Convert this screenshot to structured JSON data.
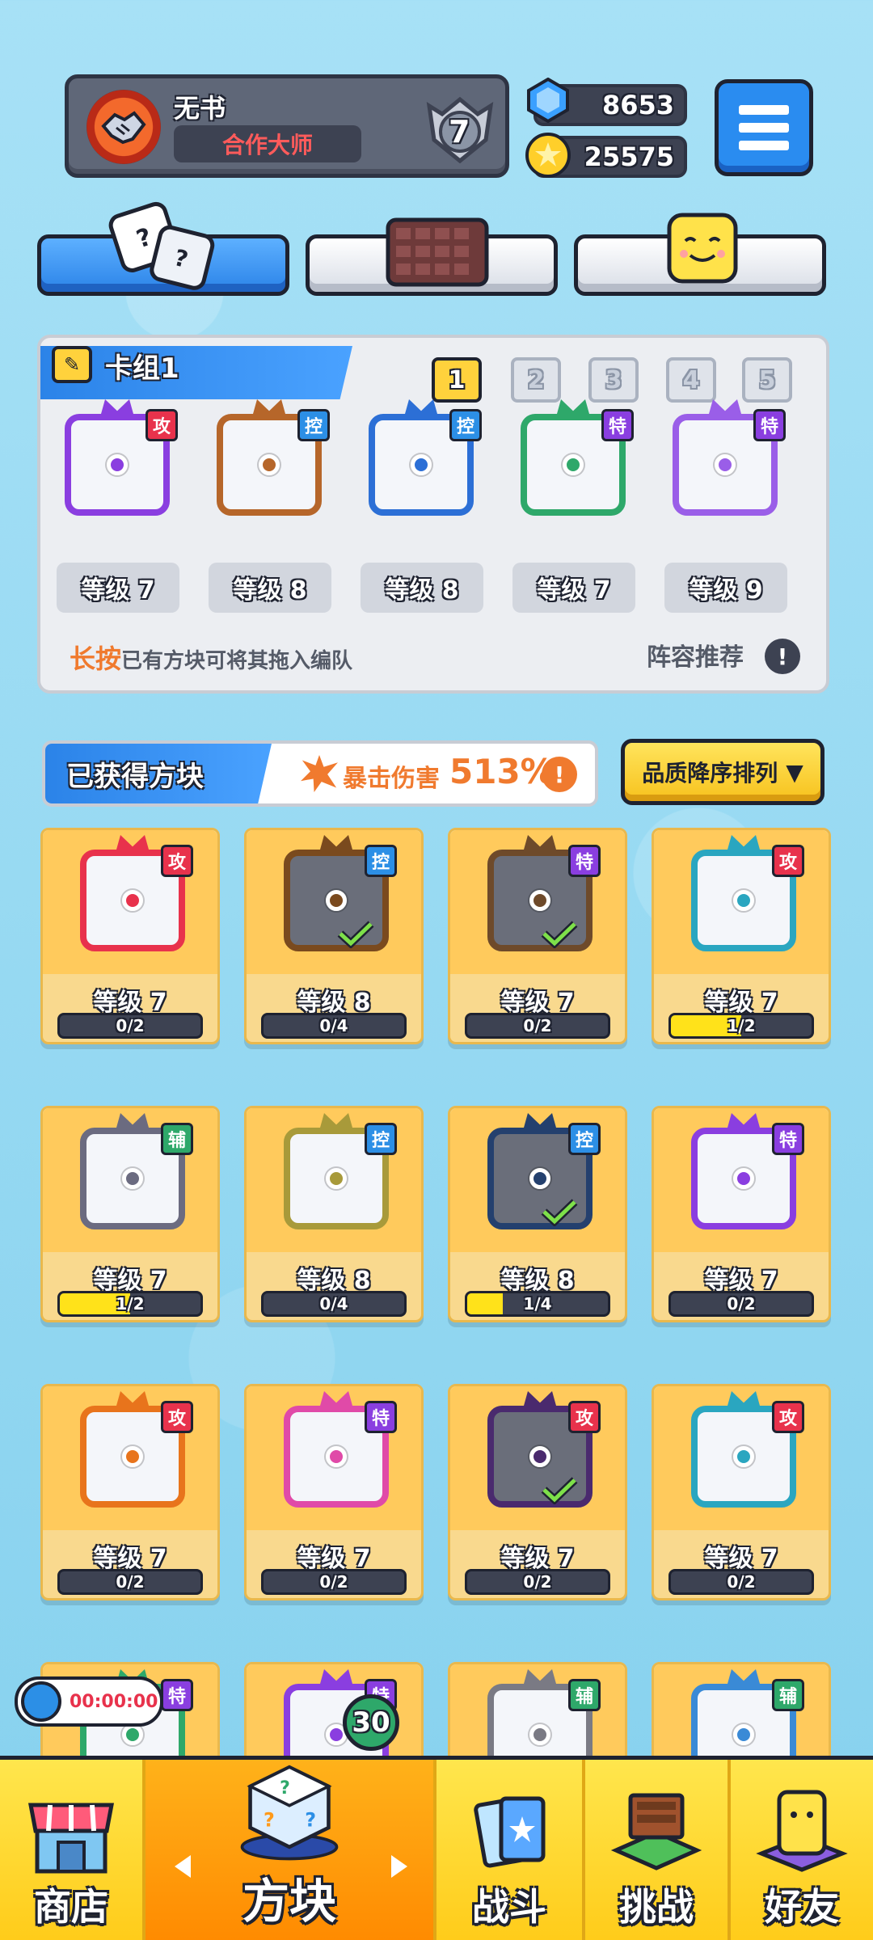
{
  "profile": {
    "name": "无书",
    "title": "合作大师",
    "rank": "7"
  },
  "currency": {
    "gems": "8653",
    "coins": "25575"
  },
  "deck": {
    "title": "卡组1",
    "numbers": [
      "1",
      "2",
      "3",
      "4",
      "5"
    ],
    "active_index": 0,
    "dice": [
      {
        "badge": "攻",
        "level": "等级 7",
        "color": "#8a3ee0"
      },
      {
        "badge": "控",
        "level": "等级 8",
        "color": "#b6662a"
      },
      {
        "badge": "控",
        "level": "等级 8",
        "color": "#2c6fd6"
      },
      {
        "badge": "特",
        "level": "等级 7",
        "color": "#2ea86a"
      },
      {
        "badge": "特",
        "level": "等级 9",
        "color": "#9a5ee8"
      }
    ],
    "hint_highlight": "长按",
    "hint_text": "已有方块可将其拖入编队",
    "recommend": "阵容推荐",
    "recommend_icon": "!"
  },
  "obtained": {
    "title": "已获得方块",
    "crit_label": "暴击伤害",
    "crit_value": "513%",
    "crit_icon": "!",
    "sort_label": "品质降序排列"
  },
  "cards": [
    {
      "badge": "攻",
      "level": "等级 7",
      "progress": "0/2",
      "fill": 0,
      "color": "#e8324c",
      "check": false,
      "dark": false
    },
    {
      "badge": "控",
      "level": "等级 8",
      "progress": "0/4",
      "fill": 0,
      "color": "#7a4a1e",
      "check": true,
      "dark": true
    },
    {
      "badge": "特",
      "level": "等级 7",
      "progress": "0/2",
      "fill": 0,
      "color": "#6e4a2a",
      "check": true,
      "dark": true
    },
    {
      "badge": "攻",
      "level": "等级 7",
      "progress": "1/2",
      "fill": 0.5,
      "color": "#2aa6c0",
      "check": false,
      "dark": false
    },
    {
      "badge": "辅",
      "level": "等级 7",
      "progress": "1/2",
      "fill": 0.5,
      "color": "#6b6b80",
      "check": false,
      "dark": false
    },
    {
      "badge": "控",
      "level": "等级 8",
      "progress": "0/4",
      "fill": 0,
      "color": "#a89a3a",
      "check": false,
      "dark": false
    },
    {
      "badge": "控",
      "level": "等级 8",
      "progress": "1/4",
      "fill": 0.25,
      "color": "#24406e",
      "check": true,
      "dark": true
    },
    {
      "badge": "特",
      "level": "等级 7",
      "progress": "0/2",
      "fill": 0,
      "color": "#8a3ee0",
      "check": false,
      "dark": false
    },
    {
      "badge": "攻",
      "level": "等级 7",
      "progress": "0/2",
      "fill": 0,
      "color": "#e8741c",
      "check": false,
      "dark": false
    },
    {
      "badge": "特",
      "level": "等级 7",
      "progress": "0/2",
      "fill": 0,
      "color": "#e04aa8",
      "check": false,
      "dark": false
    },
    {
      "badge": "攻",
      "level": "等级 7",
      "progress": "0/2",
      "fill": 0,
      "color": "#4a2a6e",
      "check": true,
      "dark": true
    },
    {
      "badge": "攻",
      "level": "等级 7",
      "progress": "0/2",
      "fill": 0,
      "color": "#2aa6c0",
      "check": false,
      "dark": false
    },
    {
      "badge": "特",
      "level": "",
      "progress": "",
      "fill": 0,
      "color": "#2ea86a",
      "check": false,
      "dark": false
    },
    {
      "badge": "特",
      "level": "",
      "progress": "",
      "fill": 0,
      "color": "#8a3ee0",
      "check": false,
      "dark": false
    },
    {
      "badge": "辅",
      "level": "",
      "progress": "",
      "fill": 0,
      "color": "#7a7a84",
      "check": false,
      "dark": false
    },
    {
      "badge": "辅",
      "level": "",
      "progress": "",
      "fill": 0,
      "color": "#3a8ad6",
      "check": false,
      "dark": false
    }
  ],
  "timer": "00:00:00",
  "dice_count": "30",
  "nav": {
    "shop": "商店",
    "dice": "方块",
    "battle": "战斗",
    "challenge": "挑战",
    "friends": "好友"
  }
}
